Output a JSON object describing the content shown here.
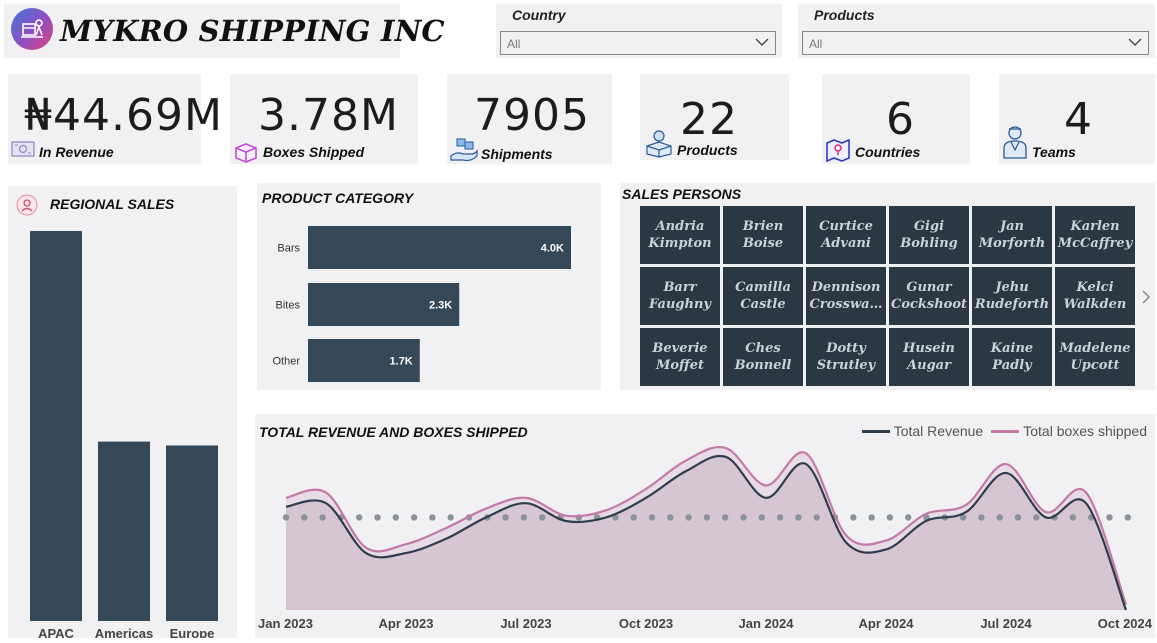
{
  "header": {
    "company_name": "MYKRO SHIPPING INC"
  },
  "filters": {
    "country": {
      "label": "Country",
      "value": "All"
    },
    "products": {
      "label": "Products",
      "value": "All"
    }
  },
  "kpis": [
    {
      "value": "₦44.69M",
      "label": "In Revenue",
      "icon": "money-icon"
    },
    {
      "value": "3.78M",
      "label": "Boxes Shipped",
      "icon": "box-icon"
    },
    {
      "value": "7905",
      "label": "Shipments",
      "icon": "shipment-icon"
    },
    {
      "value": "22",
      "label": "Products",
      "icon": "products-icon"
    },
    {
      "value": "6",
      "label": "Countries",
      "icon": "map-icon"
    },
    {
      "value": "4",
      "label": "Teams",
      "icon": "team-icon"
    }
  ],
  "regional_sales": {
    "title": "REGIONAL  SALES"
  },
  "product_category": {
    "title": "PRODUCT CATEGORY"
  },
  "sales_persons": {
    "title": "SALES PERSONS",
    "names": [
      "Andria\nKimpton",
      "Brien\nBoise",
      "Curtice\nAdvani",
      "Gigi\nBohling",
      "Jan\nMorforth",
      "Karlen\nMcCaffrey",
      "Barr\nFaughny",
      "Camilla\nCastle",
      "Dennison\nCrosswa…",
      "Gunar\nCockshoot",
      "Jehu\nRudeforth",
      "Kelci\nWalkden",
      "Beverie\nMoffet",
      "Ches\nBonnell",
      "Dotty\nStrutley",
      "Husein\nAugar",
      "Kaine\nPadly",
      "Madelene\nUpcott"
    ]
  },
  "revenue_chart": {
    "title": "TOTAL REVENUE AND BOXES SHIPPED"
  },
  "colors": {
    "bar": "#344857",
    "revenue_line": "#2f3e4c",
    "boxes_line": "#c479a6",
    "area_fill": "#d6c6d1",
    "avg_dots": "#8a929a"
  },
  "chart_data": [
    {
      "type": "bar",
      "title": "REGIONAL  SALES",
      "categories": [
        "APAC",
        "Americas",
        "Europe"
      ],
      "values": [
        100,
        46,
        45
      ],
      "ylim": [
        0,
        100
      ],
      "grid": false
    },
    {
      "type": "bar",
      "orientation": "horizontal",
      "title": "PRODUCT CATEGORY",
      "categories": [
        "Bars",
        "Bites",
        "Other"
      ],
      "values": [
        4000,
        2300,
        1700
      ],
      "data_labels": [
        "4.0K",
        "2.3K",
        "1.7K"
      ],
      "grid": false
    },
    {
      "type": "area",
      "title": "TOTAL REVENUE AND BOXES SHIPPED",
      "x": [
        "2023-01",
        "2023-02",
        "2023-03",
        "2023-04",
        "2023-05",
        "2023-06",
        "2023-07",
        "2023-08",
        "2023-09",
        "2023-10",
        "2023-11",
        "2023-12",
        "2024-01",
        "2024-02",
        "2024-03",
        "2024-04",
        "2024-05",
        "2024-06",
        "2024-07",
        "2024-08",
        "2024-09",
        "2024-10"
      ],
      "tick_labels": [
        "Jan 2023",
        "Apr 2023",
        "Jul 2023",
        "Oct 2023",
        "Jan 2024",
        "Apr 2024",
        "Jul 2024",
        "Oct 2024"
      ],
      "series": [
        {
          "name": "Total Revenue",
          "values": [
            58,
            60,
            32,
            32,
            40,
            52,
            60,
            50,
            52,
            63,
            78,
            86,
            63,
            82,
            38,
            34,
            50,
            55,
            77,
            52,
            60,
            0
          ]
        },
        {
          "name": "Total boxes shipped",
          "values": [
            63,
            66,
            35,
            37,
            46,
            57,
            63,
            53,
            56,
            68,
            84,
            91,
            70,
            88,
            42,
            39,
            54,
            59,
            82,
            55,
            66,
            3
          ]
        }
      ],
      "average_line": 52,
      "ylim": [
        0,
        100
      ],
      "legend": "top-right",
      "grid": false
    }
  ]
}
